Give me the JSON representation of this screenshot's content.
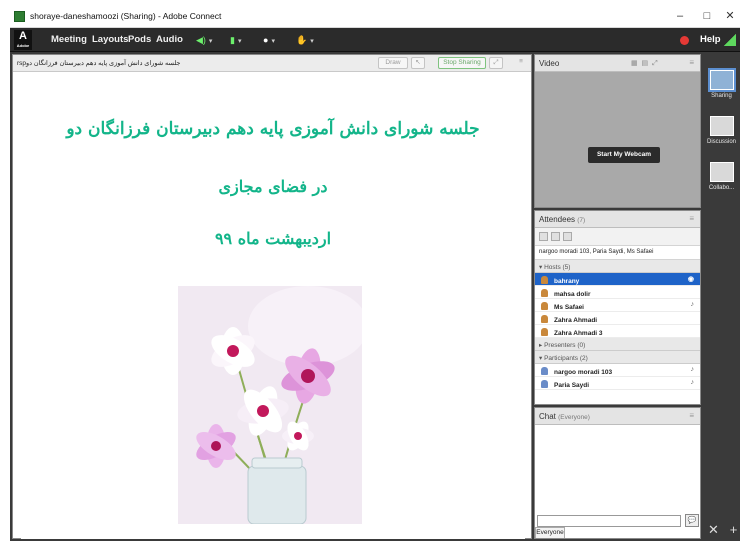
{
  "window": {
    "title": "shoraye-daneshamoozi (Sharing) - Adobe Connect",
    "min_glyph": "–",
    "max_glyph": "□",
    "close_glyph": "✕"
  },
  "menu": {
    "logo": "A",
    "logo_sub": "Adobe",
    "items": [
      "Meeting",
      "Layouts",
      "Pods",
      "Audio"
    ],
    "speaker_glyph": "◀)",
    "mic_glyph": "🎤",
    "camera_glyph": "●",
    "hand_glyph": "✋",
    "caret": "▾",
    "help": "Help"
  },
  "share_pod": {
    "document_title": "rspجلسه شورای دانش آموزی پایه دهم دبیرستان فرزانگان دو",
    "draw_label": "Draw",
    "stop_sharing_label": "Stop Sharing",
    "slide_line1": "جلسه  شورای دانش آموزی پایه دهم دبیرستان فرزانگان دو",
    "slide_line2": "در فضای مجازی",
    "slide_line3": "اردیبهشت ماه ۹۹"
  },
  "video_pod": {
    "title": "Video",
    "start_webcam_label": "Start My Webcam"
  },
  "attendees_pod": {
    "title": "Attendees",
    "count": "(7)",
    "status_line": "nargoo moradi 103, Paria Saydi, Ms Safaei",
    "hosts_label": "Hosts (5)",
    "hosts": [
      "bahrany",
      "mahsa dolir",
      "Ms Safaei",
      "Zahra Ahmadi",
      "Zahra Ahmadi 3"
    ],
    "presenters_label": "Presenters (0)",
    "participants_label": "Participants (2)",
    "participants": [
      "nargoo moradi 103",
      "Paria Saydi"
    ]
  },
  "chat_pod": {
    "title": "Chat",
    "scope": "(Everyone)",
    "send_glyph": "💬",
    "tab_label": "Everyone"
  },
  "layouts": {
    "items": [
      "Sharing",
      "Discussion",
      "Collabo..."
    ],
    "add_glyph": "+",
    "remove_glyph": "✕"
  },
  "colors": {
    "slide_text": "#13b58a",
    "selected_row": "#1e63c8",
    "stop_sharing": "#7fc37f",
    "record": "#e53935"
  }
}
